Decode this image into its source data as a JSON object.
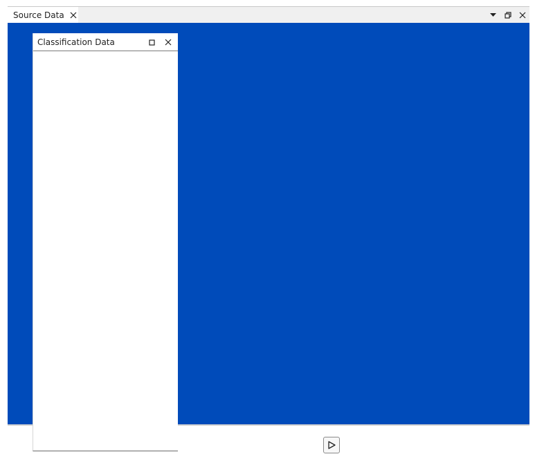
{
  "tab": {
    "label": "Source Data",
    "close_icon": "close-icon"
  },
  "window_controls": {
    "menu_icon": "dropdown-arrow-icon",
    "restore_icon": "restore-window-icon",
    "close_icon": "close-icon"
  },
  "canvas": {
    "background": "#004bba"
  },
  "panel": {
    "title": "Classification Data",
    "maximize_icon": "maximize-icon",
    "close_icon": "close-icon"
  },
  "footer": {
    "play_icon": "play-icon"
  }
}
